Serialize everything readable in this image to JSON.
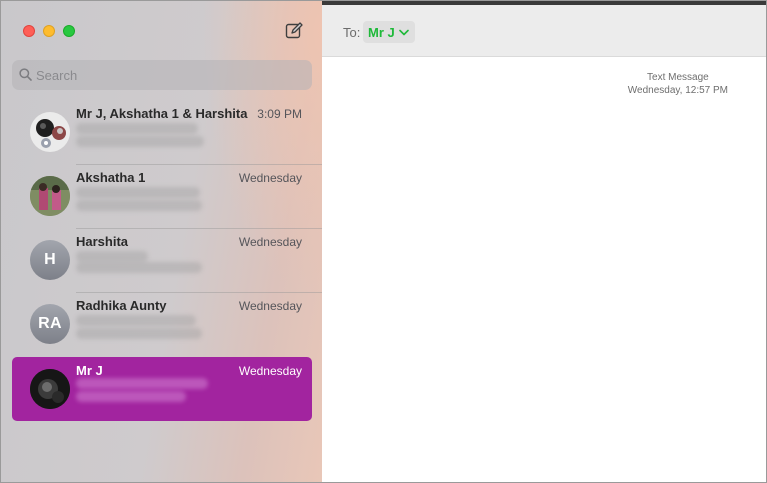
{
  "window_controls": [
    "close",
    "minimize",
    "zoom"
  ],
  "sidebar": {
    "compose_icon": "compose-icon",
    "search": {
      "placeholder": "Search",
      "value": "",
      "icon": "search-icon"
    },
    "conversations": [
      {
        "name": "Mr J, Akshatha 1 & Harshita",
        "time": "3:09 PM",
        "selected": false,
        "avatar": "group"
      },
      {
        "name": "Akshatha 1",
        "time": "Wednesday",
        "selected": false,
        "avatar": "photo"
      },
      {
        "name": "Harshita",
        "time": "Wednesday",
        "selected": false,
        "avatar": "initials",
        "initials": "H"
      },
      {
        "name": "Radhika Aunty",
        "time": "Wednesday",
        "selected": false,
        "avatar": "initials",
        "initials": "RA"
      },
      {
        "name": "Mr J",
        "time": "Wednesday",
        "selected": true,
        "avatar": "photo"
      }
    ],
    "selected_color": "#a2249f"
  },
  "main": {
    "to_label": "To:",
    "recipient": {
      "name": "Mr J",
      "color": "#1fb93a"
    },
    "message_meta": {
      "service": "Text Message",
      "timestamp": "Wednesday, 12:57 PM"
    }
  }
}
